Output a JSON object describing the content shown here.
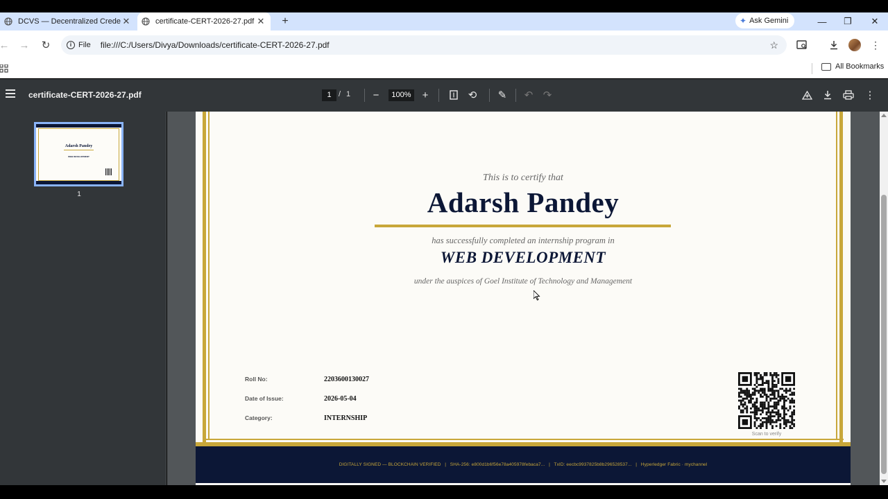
{
  "browser": {
    "tabs": [
      {
        "title": "DCVS — Decentralized Credent",
        "active": false
      },
      {
        "title": "certificate-CERT-2026-27.pdf",
        "active": true
      }
    ],
    "new_tab": "+",
    "gemini_label": "Ask Gemini",
    "security_chip": "File",
    "url": "file:///C:/Users/Divya/Downloads/certificate-CERT-2026-27.pdf",
    "bookmarks_label": "All Bookmarks"
  },
  "pdf_viewer": {
    "title": "certificate-CERT-2026-27.pdf",
    "current_page": "1",
    "page_separator": "/",
    "total_pages": "1",
    "zoom": "100%",
    "thumbnail_label": "1"
  },
  "certificate": {
    "intro": "This is to certify that",
    "recipient": "Adarsh Pandey",
    "completed_text": "has successfully completed an internship program in",
    "program": "WEB DEVELOPMENT",
    "auspices": "under the auspices of Goel Institute of Technology and Management",
    "details": [
      {
        "label": "Roll No:",
        "value": "2203600130027"
      },
      {
        "label": "Date of Issue:",
        "value": "2026-05-04"
      },
      {
        "label": "Category:",
        "value": "INTERNSHIP"
      }
    ],
    "qr_caption": "Scan to verify",
    "footer": "DIGITALLY SIGNED — BLOCKCHAIN VERIFIED   |   SHA-256: e800d1b6f56e78a405978febaca7...   |   TxID: eecbc9937825b8b296528537...   |   Hyperledger Fabric · mychannel"
  },
  "colors": {
    "navy": "#0c1736",
    "gold": "#c8a73a",
    "tabstrip": "#d3e3fd",
    "pdf_toolbar": "#323639",
    "viewer_bg": "#525659"
  }
}
